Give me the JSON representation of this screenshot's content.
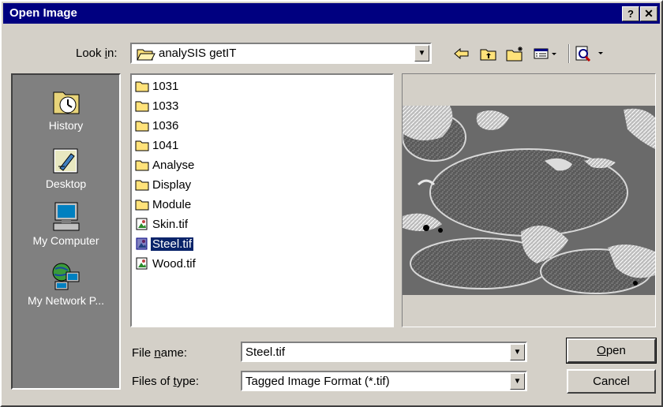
{
  "window": {
    "title": "Open Image",
    "help": "?",
    "close": "✕"
  },
  "lookin": {
    "label_pre": "Look ",
    "label_key": "i",
    "label_post": "n:",
    "value": "analySIS getIT"
  },
  "toolbar": {
    "icons": [
      "back-arrow-icon",
      "up-folder-icon",
      "new-folder-icon",
      "view-menu-icon",
      "tools-icon"
    ]
  },
  "places": [
    {
      "label": "History",
      "icon": "history-icon"
    },
    {
      "label": "Desktop",
      "icon": "desktop-icon"
    },
    {
      "label": "My Computer",
      "icon": "my-computer-icon"
    },
    {
      "label": "My Network P...",
      "icon": "network-places-icon"
    }
  ],
  "files": [
    {
      "name": "1031",
      "type": "folder"
    },
    {
      "name": "1033",
      "type": "folder"
    },
    {
      "name": "1036",
      "type": "folder"
    },
    {
      "name": "1041",
      "type": "folder"
    },
    {
      "name": "Analyse",
      "type": "folder"
    },
    {
      "name": "Display",
      "type": "folder"
    },
    {
      "name": "Module",
      "type": "folder"
    },
    {
      "name": "Skin.tif",
      "type": "image"
    },
    {
      "name": "Steel.tif",
      "type": "image",
      "selected": true
    },
    {
      "name": "Wood.tif",
      "type": "image"
    }
  ],
  "filename": {
    "label_pre": "File ",
    "label_key": "n",
    "label_post": "ame:",
    "value": "Steel.tif"
  },
  "filetype": {
    "label_pre": "Files of ",
    "label_key": "t",
    "label_post": "ype:",
    "value": "Tagged Image Format (*.tif)"
  },
  "buttons": {
    "open_key": "O",
    "open_rest": "pen",
    "cancel": "Cancel"
  },
  "colors": {
    "title_bar": "#000080",
    "face": "#d4d0c8",
    "places_bg": "#808080",
    "selection": "#0a246a",
    "folder": "#ffe27a"
  }
}
